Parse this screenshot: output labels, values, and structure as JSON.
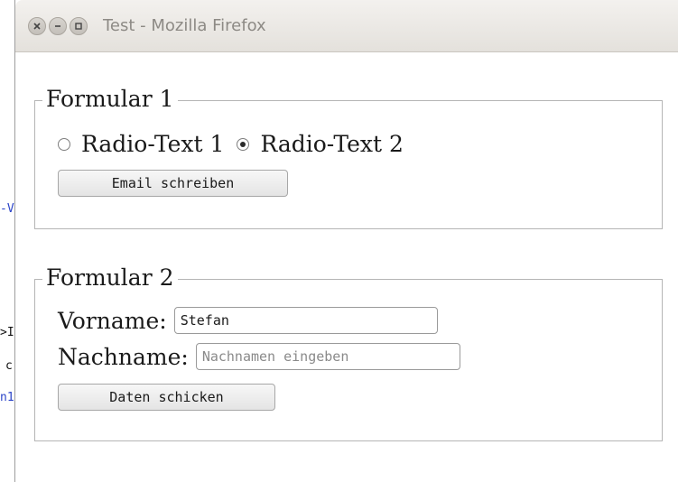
{
  "background_fragments": [
    "-V",
    ">I",
    "c",
    "n1"
  ],
  "window": {
    "title": "Test - Mozilla Firefox",
    "controls": [
      "close-icon",
      "minimize-icon",
      "maximize-icon"
    ]
  },
  "form1": {
    "legend": "Formular 1",
    "radios": [
      {
        "label": "Radio-Text 1",
        "checked": false
      },
      {
        "label": "Radio-Text 2",
        "checked": true
      }
    ],
    "button_label": "Email schreiben"
  },
  "form2": {
    "legend": "Formular 2",
    "firstname_label": "Vorname:",
    "firstname_value": "Stefan",
    "lastname_label": "Nachname:",
    "lastname_value": "",
    "lastname_placeholder": "Nachnamen eingeben",
    "button_label": "Daten schicken"
  },
  "colors": {
    "titlebar": "#e4e1dc",
    "fieldset_border": "#b5b5b5",
    "link_blue": "#1f3fb5"
  }
}
